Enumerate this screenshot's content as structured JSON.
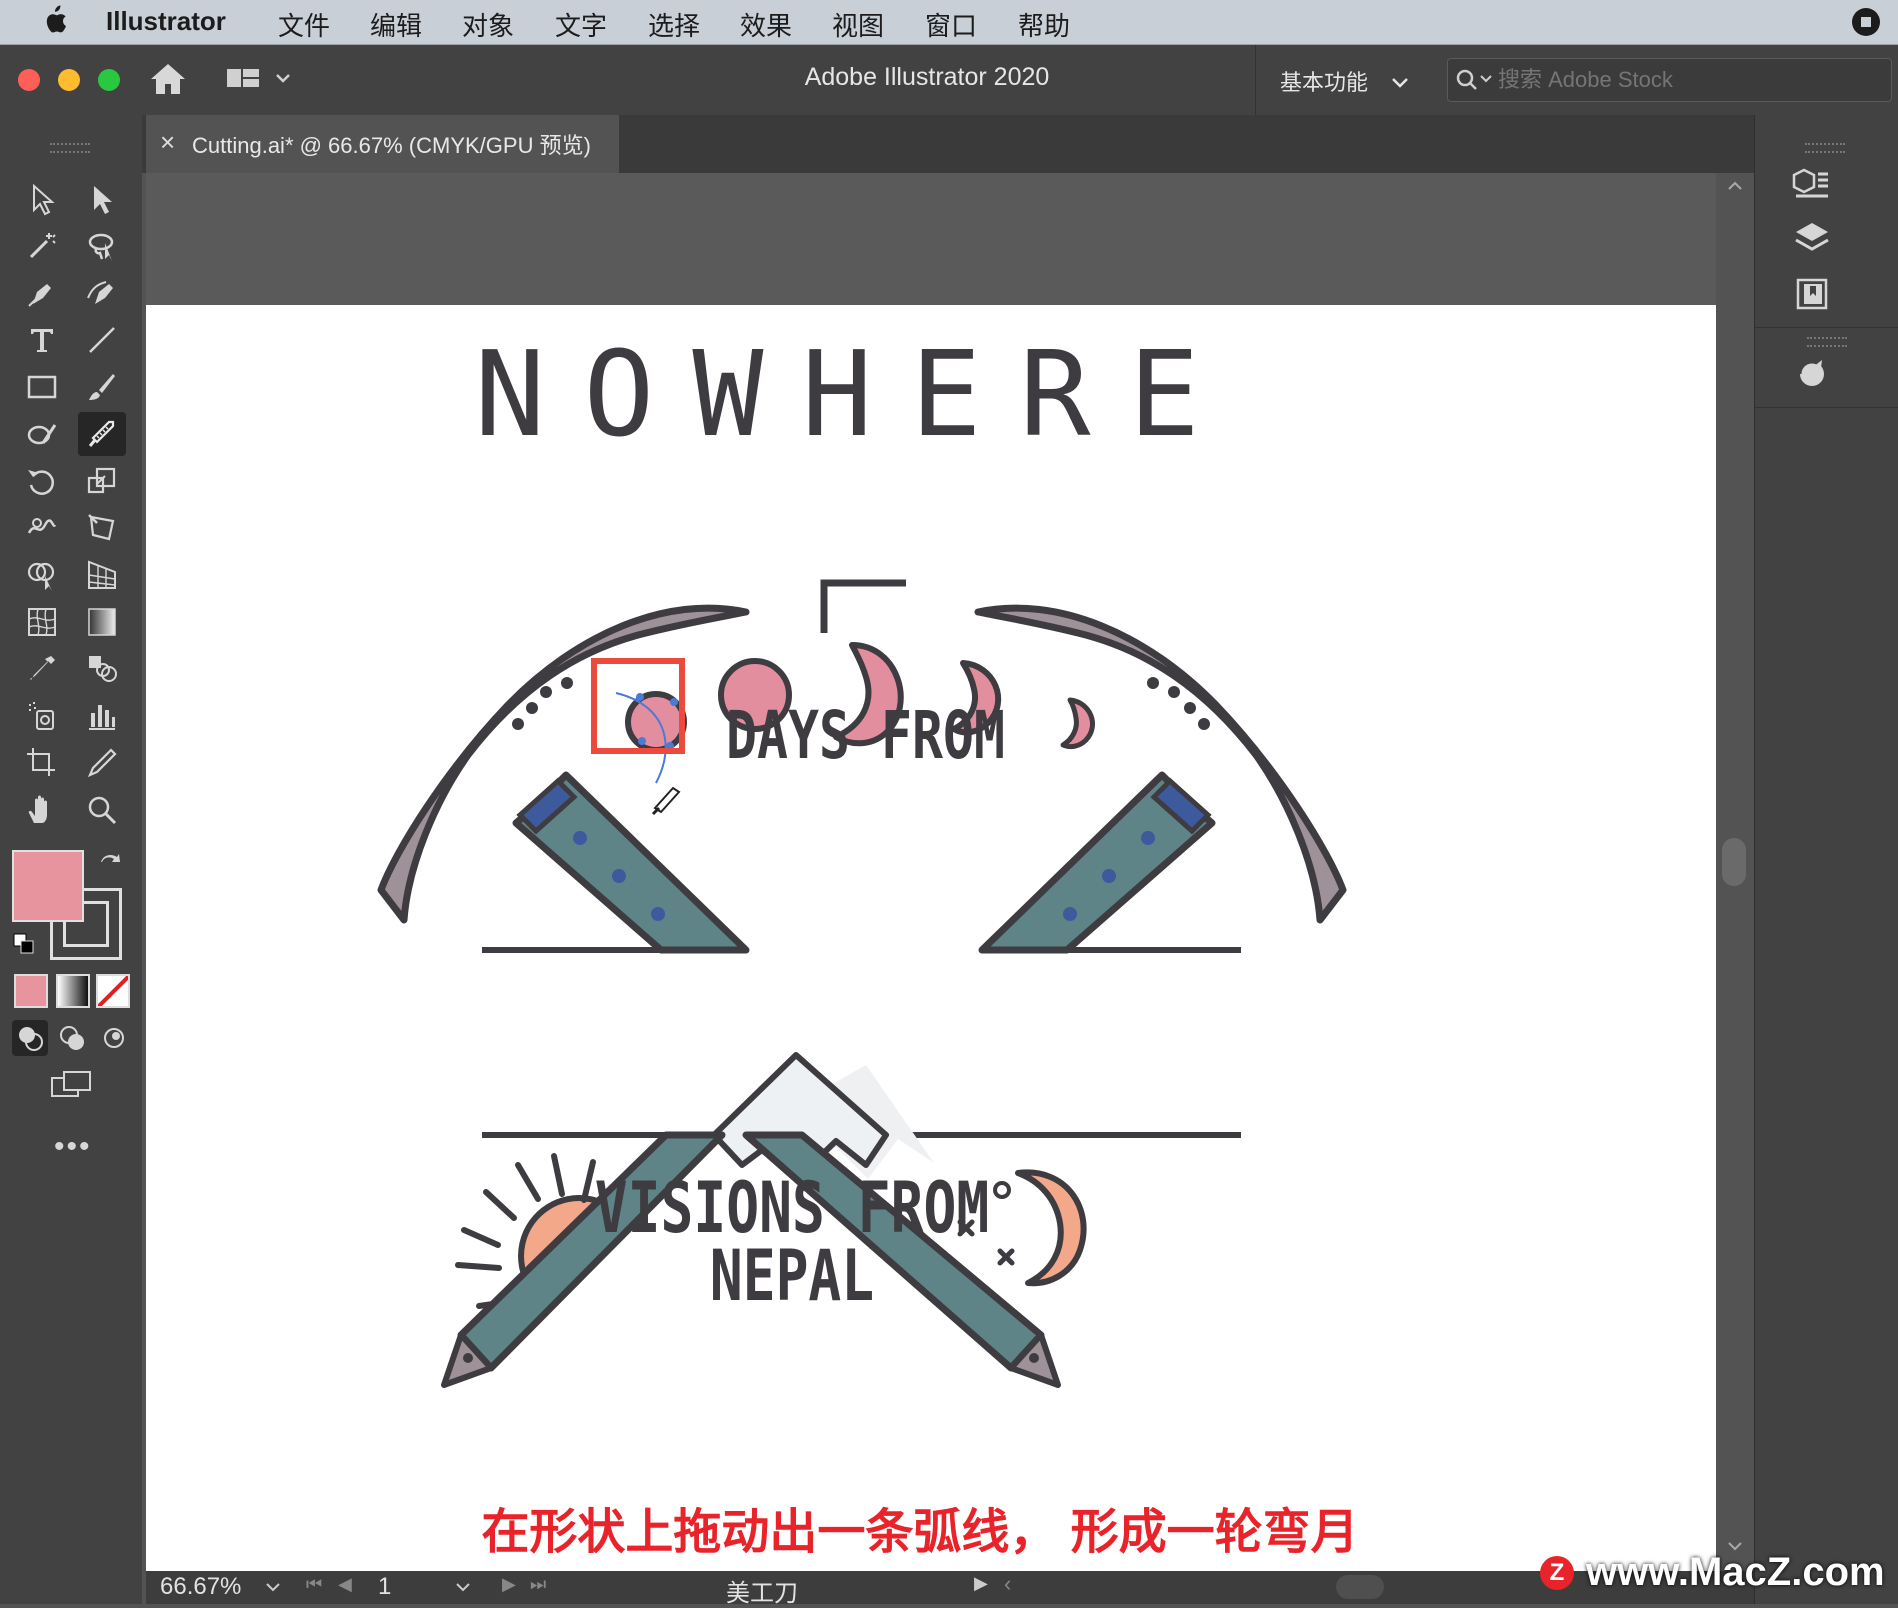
{
  "menubar": {
    "app": "Illustrator",
    "items": [
      "文件",
      "编辑",
      "对象",
      "文字",
      "选择",
      "效果",
      "视图",
      "窗口",
      "帮助"
    ]
  },
  "appbar": {
    "title": "Adobe Illustrator 2020",
    "workspace": "基本功能",
    "search_placeholder": "搜索 Adobe Stock"
  },
  "tab": {
    "close": "×",
    "label": "Cutting.ai* @ 66.67% (CMYK/GPU 预览)"
  },
  "artwork": {
    "headline": "NOWHERE",
    "sub1": "DAYS FROM",
    "sub2_line1": "VISIONS FROM",
    "sub2_line2": "NEPAL"
  },
  "status": {
    "zoom": "66.67%",
    "page": "1",
    "tool": "美工刀"
  },
  "subtitle": "在形状上拖动出一条弧线， 形成一轮弯月",
  "watermark": "www.MacZ.com",
  "colors": {
    "fill_swatch": "#e8949f",
    "pink": "#e38e9e",
    "slate": "#5e8488",
    "pick_gray": "#9e9298",
    "outline": "#3e3c40",
    "sun": "#f3a88a",
    "highlight_box": "#ec4a3c"
  },
  "icons": [
    "apple-icon",
    "home-icon",
    "workspace-switcher-icon",
    "search-icon",
    "selection-tool-icon",
    "direct-selection-tool-icon",
    "magic-wand-icon",
    "lasso-icon",
    "pen-tool-icon",
    "curvature-tool-icon",
    "type-tool-icon",
    "line-tool-icon",
    "rectangle-tool-icon",
    "paintbrush-icon",
    "shaper-tool-icon",
    "knife-tool-icon",
    "rotate-tool-icon",
    "scale-tool-icon",
    "warp-tool-icon",
    "free-transform-icon",
    "shape-builder-icon",
    "perspective-grid-icon",
    "mesh-tool-icon",
    "gradient-tool-icon",
    "eyedropper-icon",
    "blend-tool-icon",
    "symbol-sprayer-icon",
    "graph-tool-icon",
    "artboard-tool-icon",
    "slice-tool-icon",
    "hand-tool-icon",
    "zoom-tool-icon",
    "properties-icon",
    "layers-icon",
    "libraries-icon",
    "cc-sync-icon"
  ]
}
